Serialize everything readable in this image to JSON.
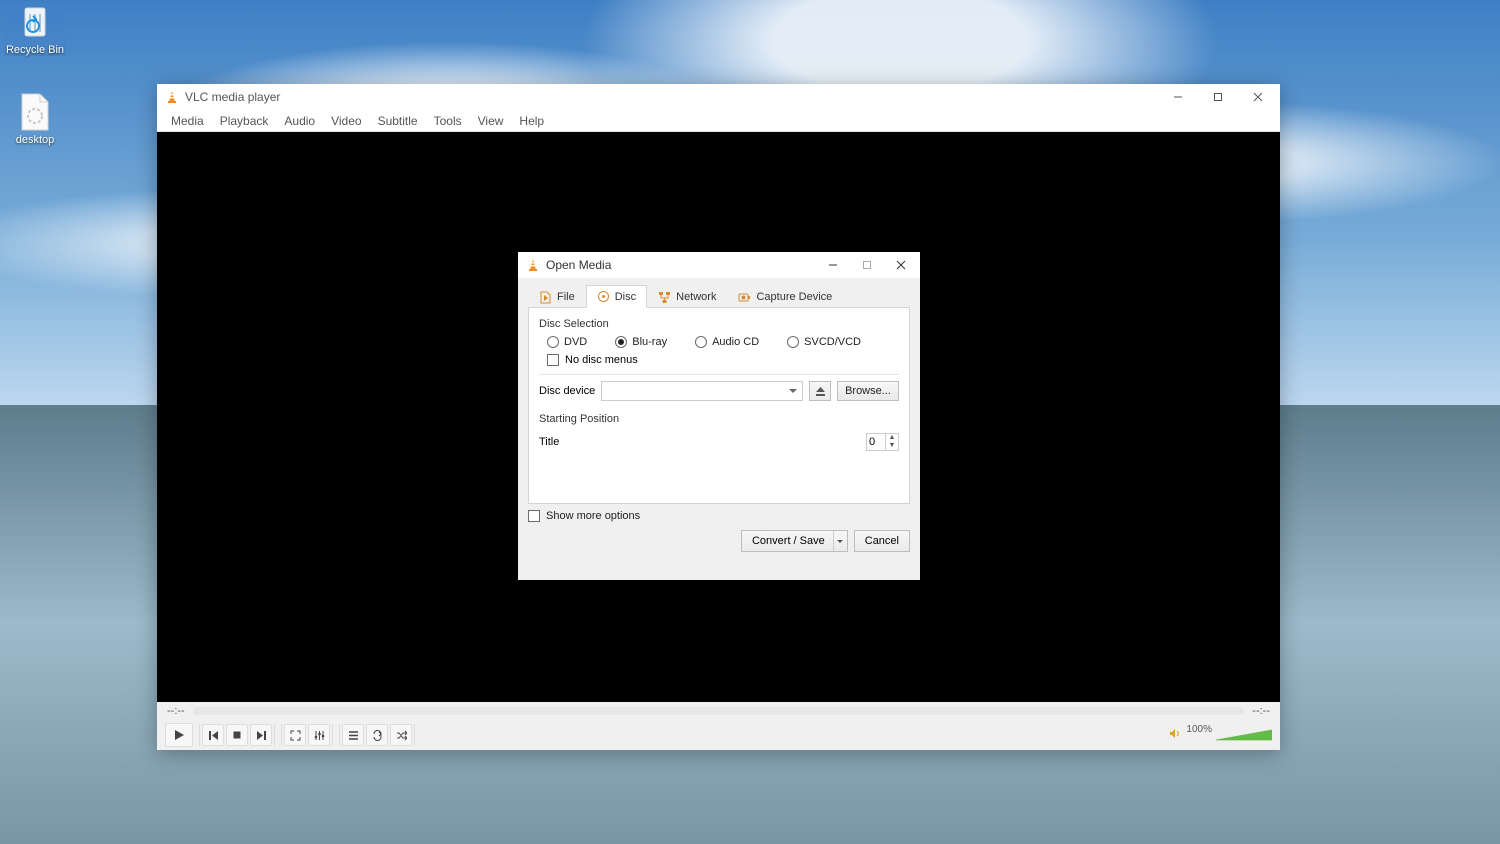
{
  "desktop": {
    "recycle_label": "Recycle Bin",
    "folder_label": "desktop"
  },
  "vlc": {
    "title": "VLC media player",
    "menus": [
      "Media",
      "Playback",
      "Audio",
      "Video",
      "Subtitle",
      "Tools",
      "View",
      "Help"
    ],
    "time_left": "--:--",
    "time_right": "--:--",
    "volume_label": "100%"
  },
  "dialog": {
    "title": "Open Media",
    "tabs": {
      "file": "File",
      "disc": "Disc",
      "network": "Network",
      "capture": "Capture Device"
    },
    "disc_selection_label": "Disc Selection",
    "disc_types": {
      "dvd": "DVD",
      "bluray": "Blu-ray",
      "audiocd": "Audio CD",
      "svcd": "SVCD/VCD"
    },
    "selected_disc_type": "bluray",
    "no_disc_menus_label": "No disc menus",
    "disc_device_label": "Disc device",
    "disc_device_value": "",
    "browse_label": "Browse...",
    "starting_position_label": "Starting Position",
    "title_label": "Title",
    "title_value": "0",
    "show_more_label": "Show more options",
    "convert_label": "Convert / Save",
    "cancel_label": "Cancel"
  }
}
